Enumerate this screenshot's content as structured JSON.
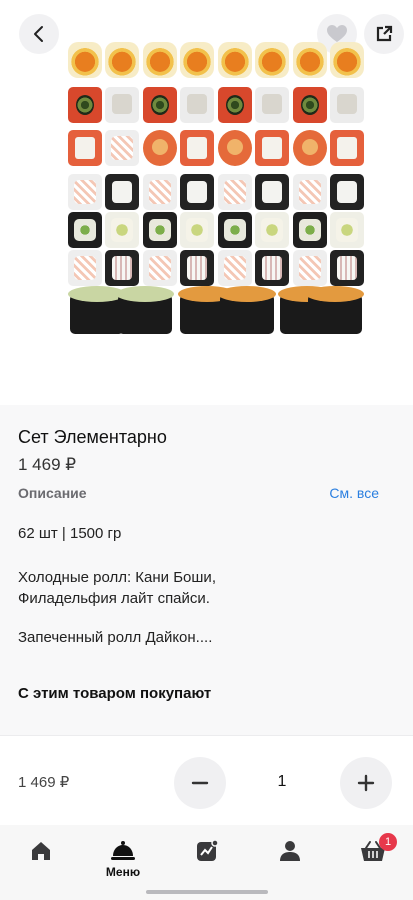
{
  "product": {
    "title": "Сет Элементарно",
    "price": "1 469 ₽",
    "description_label": "Описание",
    "see_all": "См. все",
    "description_lines": [
      "62 шт | 1500 гр",
      "Холодные ролл: Кани Боши, Филадельфия лайт спайси.",
      "Запеченный ролл Дайкон...."
    ],
    "also_bought": "С этим товаром покупают"
  },
  "cart": {
    "price": "1 469 ₽",
    "quantity": "1"
  },
  "tabbar": {
    "items": [
      {
        "icon": "home-icon",
        "label": ""
      },
      {
        "icon": "menu-cloche-icon",
        "label": "Меню"
      },
      {
        "icon": "promo-chart-icon",
        "label": ""
      },
      {
        "icon": "profile-icon",
        "label": ""
      },
      {
        "icon": "cart-basket-icon",
        "label": "",
        "badge": "1"
      }
    ]
  },
  "colors": {
    "accent_link": "#2b7fe0",
    "badge": "#e7384b"
  }
}
